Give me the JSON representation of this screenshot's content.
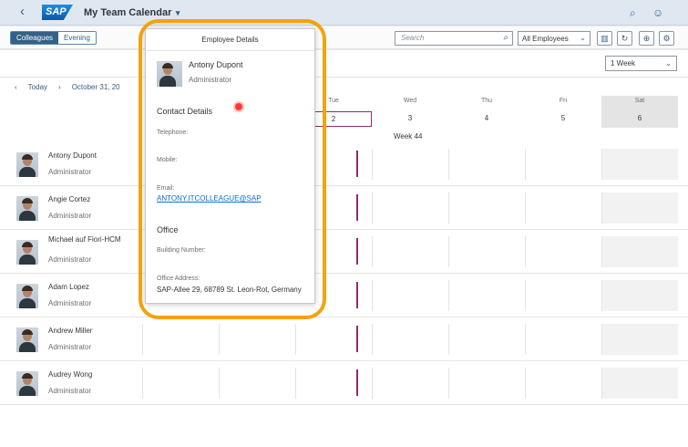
{
  "shell": {
    "title": "My Team Calendar",
    "back_icon": "chevron-left-icon",
    "logo": "SAP",
    "search_icon": "search-icon",
    "user_icon": "user-icon"
  },
  "toolbar": {
    "segments": [
      "Colleagues",
      "Evening"
    ],
    "search_placeholder": "Search",
    "filter_value": "All Employees"
  },
  "view_select": "1 Week",
  "navigation": {
    "today": "Today",
    "range": "October 31, 20"
  },
  "days": [
    {
      "name": "Tue",
      "date": "2"
    },
    {
      "name": "Wed",
      "date": "3"
    },
    {
      "name": "Thu",
      "date": "4"
    },
    {
      "name": "Fri",
      "date": "5"
    },
    {
      "name": "Sat",
      "date": "6"
    }
  ],
  "week_label": "Week 44",
  "people": [
    {
      "name": "Antony Dupont",
      "role": "Administrator"
    },
    {
      "name": "Angie Cortez",
      "role": "Administrator"
    },
    {
      "name": "Michael auf Fiori-HCM",
      "role": "Administrator"
    },
    {
      "name": "Adam Lopez",
      "role": "Administrator"
    },
    {
      "name": "Andrew Miller",
      "role": "Administrator"
    },
    {
      "name": "Audrey Wong",
      "role": "Administrator"
    }
  ],
  "popover": {
    "title": "Employee Details",
    "name": "Antony Dupont",
    "role": "Administrator",
    "contact_heading": "Contact Details",
    "telephone_label": "Telephone:",
    "mobile_label": "Mobile:",
    "email_label": "Email:",
    "email_value": "ANTONY.ITCOLLEAGUE@SAP",
    "office_heading": "Office",
    "building_label": "Building Number:",
    "address_label": "Office Address:",
    "address_value": "SAP-Allee 29, 68789 St. Leon-Rot, Germany"
  },
  "colors": {
    "accent": "#346187",
    "today_marker": "#8f2c6c",
    "highlight": "#f5a20a"
  }
}
